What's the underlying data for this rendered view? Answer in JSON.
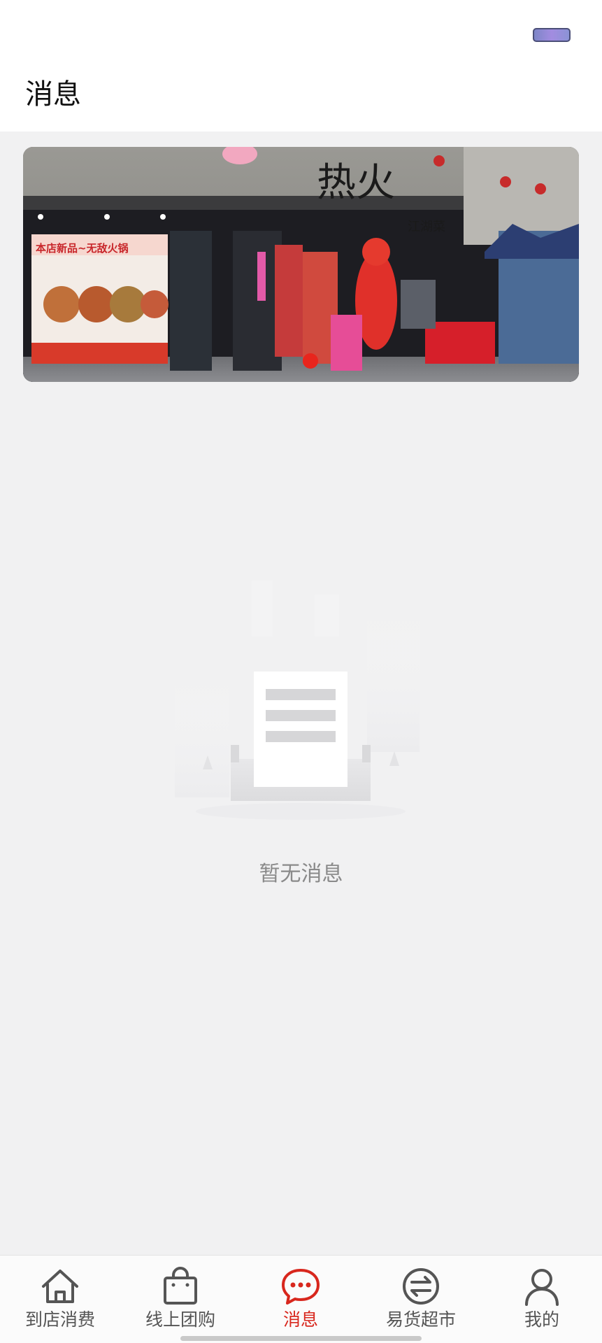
{
  "header": {
    "title": "消息"
  },
  "banner": {
    "image": "storefront-photo",
    "sign_main": "热火",
    "sign_sub": "江湖菜",
    "poster_title": "本店新品~无敌火锅"
  },
  "empty_state": {
    "icon": "empty-document-icon",
    "text": "暂无消息"
  },
  "tabbar": {
    "active_color": "#d8271d",
    "inactive_color": "#555555",
    "items": [
      {
        "label": "到店消费",
        "icon": "home-icon",
        "active": false
      },
      {
        "label": "线上团购",
        "icon": "shopping-bag-icon",
        "active": false
      },
      {
        "label": "消息",
        "icon": "chat-bubble-icon",
        "active": true
      },
      {
        "label": "易货超市",
        "icon": "exchange-icon",
        "active": false
      },
      {
        "label": "我的",
        "icon": "user-icon",
        "active": false
      }
    ]
  }
}
